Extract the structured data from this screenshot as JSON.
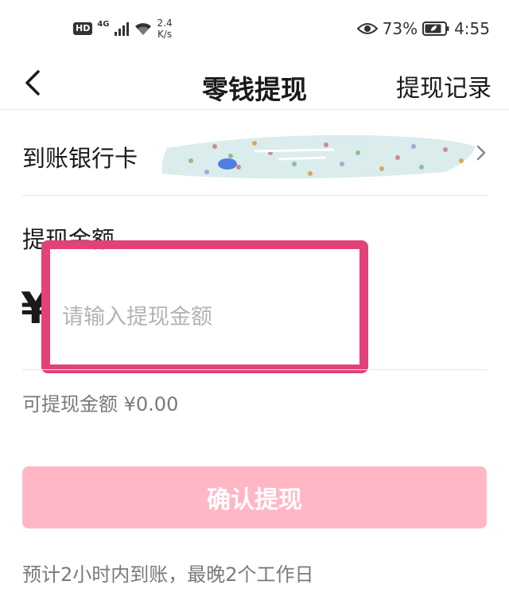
{
  "status_bar": {
    "hd": "HD",
    "network": "4G",
    "speed_value": "2.4",
    "speed_unit": "K/s",
    "battery": "73%",
    "time": "4:55"
  },
  "header": {
    "title": "零钱提现",
    "record_label": "提现记录",
    "back_icon": "chevron-left-icon"
  },
  "bank": {
    "label": "到账银行卡",
    "value_obscured": true
  },
  "amount": {
    "label": "提现金额",
    "currency": "¥",
    "placeholder": "请输入提现金额",
    "value": ""
  },
  "available": {
    "text": "可提现金额 ¥0.00"
  },
  "confirm": {
    "label": "确认提现"
  },
  "hint": {
    "text": "预计2小时内到账，最晚2个工作日"
  },
  "colors": {
    "highlight": "#e2417a",
    "button_bg": "#ffb7c6",
    "muted_text": "#7a7a7a",
    "placeholder": "#b3b3b3"
  }
}
